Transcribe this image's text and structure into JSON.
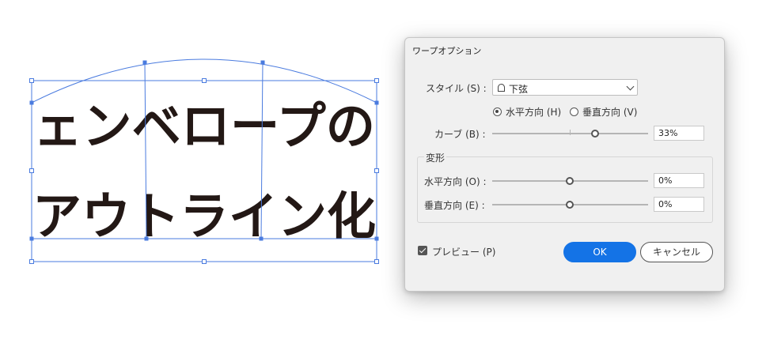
{
  "artwork": {
    "line1": "ェンベロープの",
    "line2": "アウトライン化",
    "accent_color": "#4a7bdf",
    "text_color": "#231815"
  },
  "dialog": {
    "title": "ワープオプション",
    "style_label": "スタイル (S) :",
    "style_value": "下弦",
    "style_icon": "arc-lower-icon",
    "orientation": {
      "horizontal_label": "水平方向 (H)",
      "vertical_label": "垂直方向 (V)",
      "selected": "horizontal"
    },
    "bend": {
      "label": "カーブ (B) :",
      "value": "33%",
      "level": 0.33
    },
    "distortion": {
      "group_label": "変形",
      "horizontal_label": "水平方向 (O) :",
      "horizontal_value": "0%",
      "horizontal_level": 0,
      "vertical_label": "垂直方向 (E) :",
      "vertical_value": "0%",
      "vertical_level": 0
    },
    "preview_label": "プレビュー (P)",
    "preview_checked": true,
    "ok_label": "OK",
    "cancel_label": "キャンセル",
    "ok_color": "#1473e6"
  }
}
